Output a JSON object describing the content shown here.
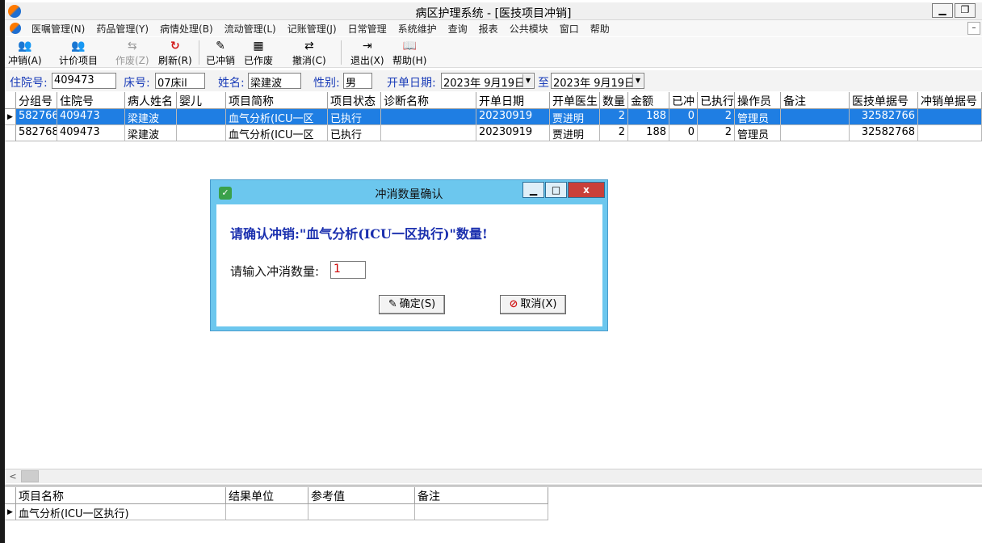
{
  "window": {
    "title": "病区护理系统 - [医技项目冲销]",
    "minimize": "▁",
    "restore": "❐"
  },
  "menu": {
    "items": [
      "医嘱管理(N)",
      "药品管理(Y)",
      "病情处理(B)",
      "流动管理(L)",
      "记账管理(J)",
      "日常管理",
      "系统维护",
      "查询",
      "报表",
      "公共模块",
      "窗口",
      "帮助"
    ],
    "mdi_minimize": "–"
  },
  "toolbar": {
    "items": [
      {
        "label": "冲销(A)",
        "icon": "person-search-icon",
        "glyph": "👥",
        "disabled": false
      },
      {
        "label": "计价项目",
        "icon": "person-search-icon",
        "glyph": "👥",
        "disabled": false
      },
      {
        "label": "作废(Z)",
        "icon": "cancel-list-icon",
        "glyph": "⇆",
        "disabled": true
      },
      {
        "label": "刷新(R)",
        "icon": "refresh-icon",
        "glyph": "↻",
        "disabled": false
      },
      {
        "label": "已冲销",
        "icon": "reversed-list-icon",
        "glyph": "✎",
        "disabled": false
      },
      {
        "label": "已作废",
        "icon": "void-list-icon",
        "glyph": "▦",
        "disabled": false
      },
      {
        "label": "撤消(C)",
        "icon": "undo-icon",
        "glyph": "⇄",
        "disabled": false
      },
      {
        "label": "退出(X)",
        "icon": "exit-icon",
        "glyph": "⇥",
        "disabled": false
      },
      {
        "label": "帮助(H)",
        "icon": "help-book-icon",
        "glyph": "📖",
        "disabled": false
      }
    ]
  },
  "filter": {
    "inpatient_no_label": "住院号:",
    "inpatient_no": "409473",
    "bed_label": "床号:",
    "bed": "07床il",
    "name_label": "姓名:",
    "name": "梁建波",
    "sex_label": "性别:",
    "sex": "男",
    "date_label": "开单日期:",
    "date_from": "2023年 9月19日",
    "to_label": "至",
    "date_to": "2023年 9月19日"
  },
  "grid": {
    "columns": [
      "分组号",
      "住院号",
      "病人姓名",
      "婴儿",
      "项目简称",
      "项目状态",
      "诊断名称",
      "开单日期",
      "开单医生",
      "数量",
      "金额",
      "已冲",
      "已执行",
      "操作员",
      "备注",
      "医技单据号",
      "冲销单据号"
    ],
    "rows": [
      [
        "582766",
        "409473",
        "梁建波",
        "",
        "血气分析(ICU一区",
        "已执行",
        "",
        "20230919",
        "贾进明",
        "2",
        "188",
        "0",
        "2",
        "管理员",
        "",
        "32582766",
        ""
      ],
      [
        "582768",
        "409473",
        "梁建波",
        "",
        "血气分析(ICU一区",
        "已执行",
        "",
        "20230919",
        "贾进明",
        "2",
        "188",
        "0",
        "2",
        "管理员",
        "",
        "32582768",
        ""
      ]
    ],
    "row_marker": "▶"
  },
  "scrollbar": {
    "left_arrow": "<"
  },
  "detail_grid": {
    "columns": [
      "项目名称",
      "结果单位",
      "参考值",
      "备注"
    ],
    "rows": [
      [
        "血气分析(ICU一区执行)",
        "",
        "",
        ""
      ]
    ]
  },
  "dialog": {
    "title": "冲消数量确认",
    "message": "请确认冲销:\"血气分析(ICU一区执行)\"数量!",
    "quantity_label": "请输入冲消数量:",
    "quantity_value": "1",
    "ok_label": "确定(S)",
    "cancel_label": "取消(X)",
    "minimize": "▁",
    "maximize": "□",
    "close": "x"
  },
  "colors": {
    "selected_row": "#1f7ee3",
    "label_blue": "#1a3cb8",
    "dialog_frame": "#6cc7ee",
    "dialog_message": "#1a2fae"
  }
}
